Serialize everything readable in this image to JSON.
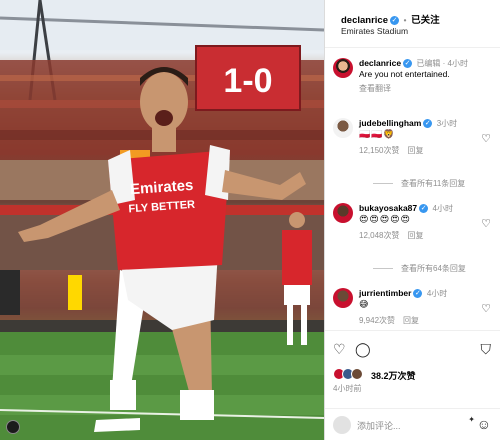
{
  "post": {
    "username": "declanrice",
    "follow_label": "已关注",
    "location": "Emirates Stadium"
  },
  "photo": {
    "scoreboard": "1-0",
    "shirt_sponsor": "Emirates FLY BETTER"
  },
  "comments": [
    {
      "username": "declanrice",
      "meta": "已编辑 · 4小时",
      "text": "Are you not entertained.",
      "translate": "查看翻译",
      "verified": true
    },
    {
      "username": "judebellingham",
      "meta": "3小时",
      "emoji": "🇵🇱🇵🇱🦁",
      "likes": "12,150次赞",
      "reply": "回复",
      "more": "查看所有11条回复",
      "verified": true
    },
    {
      "username": "bukayosaka87",
      "meta": "4小时",
      "emoji": "😍😍😍😍😍",
      "likes": "12,048次赞",
      "reply": "回复",
      "more": "查看所有64条回复",
      "verified": true
    },
    {
      "username": "jurrientimber",
      "meta": "4小时",
      "emoji": "😅",
      "likes": "9,942次赞",
      "reply": "回复",
      "verified": true
    }
  ],
  "actions": {
    "likes": "38.2万次赞",
    "time_ago": "4小时前"
  },
  "add_comment": {
    "placeholder": "添加评论..."
  }
}
